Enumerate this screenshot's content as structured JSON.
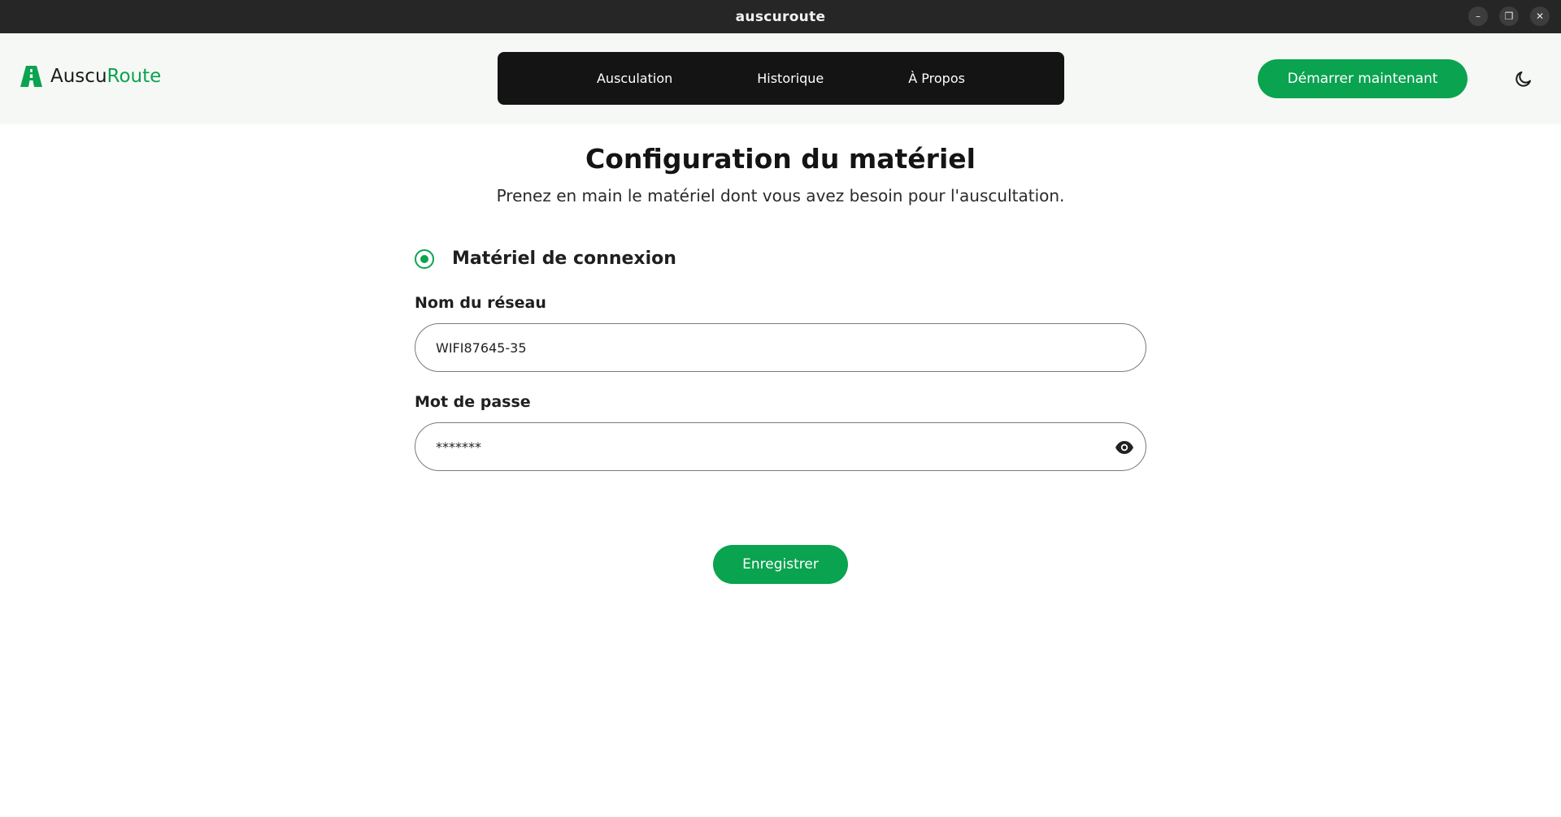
{
  "window": {
    "title": "auscuroute",
    "controls": {
      "minimize": "–",
      "restore": "❐",
      "close": "✕"
    }
  },
  "header": {
    "logo_prefix": "Auscu",
    "logo_accent": "Route",
    "nav": [
      "Ausculation",
      "Historique",
      "À Propos"
    ],
    "cta_label": "Démarrer maintenant",
    "theme_icon": "moon-icon"
  },
  "main": {
    "title": "Configuration du matériel",
    "subtitle": "Prenez en main le matériel dont vous avez besoin pour l'auscultation.",
    "section_title": "Matériel de connexion",
    "network_label": "Nom du réseau",
    "network_value": "WIFI87645-35",
    "password_label": "Mot de passe",
    "password_value": "*******",
    "save_label": "Enregistrer"
  },
  "colors": {
    "accent": "#0aa34f",
    "nav_bg": "#141414",
    "titlebar_bg": "#262626",
    "header_bg": "#f6f8f6"
  }
}
